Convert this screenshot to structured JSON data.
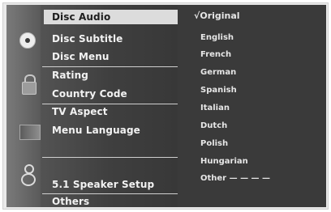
{
  "menu": {
    "items": [
      {
        "label": "Disc Audio"
      },
      {
        "label": "Disc Subtitle"
      },
      {
        "label": "Disc Menu"
      },
      {
        "label": "Rating"
      },
      {
        "label": "Country Code"
      },
      {
        "label": "TV Aspect"
      },
      {
        "label": "Menu Language"
      },
      {
        "label": "5.1 Speaker Setup"
      },
      {
        "label": "Others"
      }
    ],
    "selected_index": 0
  },
  "options": {
    "selected_marker": "√",
    "items": [
      {
        "label": "Original"
      },
      {
        "label": "English"
      },
      {
        "label": "French"
      },
      {
        "label": "German"
      },
      {
        "label": "Spanish"
      },
      {
        "label": "Italian"
      },
      {
        "label": "Dutch"
      },
      {
        "label": "Polish"
      },
      {
        "label": "Hungarian"
      },
      {
        "label": "Other — — — —"
      }
    ]
  },
  "icons": [
    "disc-icon",
    "lock-icon",
    "screen-icon",
    "speaker-icon"
  ],
  "colors": {
    "panel_dark": "#3a3a3a",
    "highlight": "#dcdcdc",
    "text": "#f2f2f2"
  }
}
